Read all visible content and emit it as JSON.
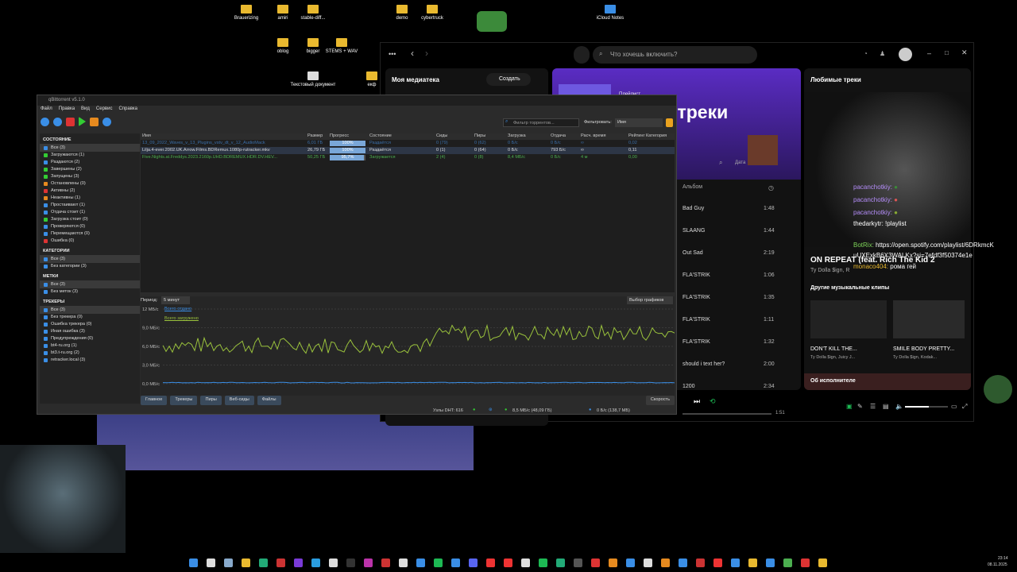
{
  "desktop": {
    "icons": [
      "Brauerizing",
      "amiri",
      "stable-diff...",
      "demo",
      "cybertruck",
      "iCloud Notes",
      "oblog",
      "bigger",
      "STEMS + WAV",
      "Текстовый документ",
      "екф"
    ]
  },
  "spotify": {
    "search_placeholder": "Что хочешь включить?",
    "library_title": "Моя медиатека",
    "create_label": "Создать",
    "playlist_title": "Любимые треки",
    "playlist_badge": "Плейлист",
    "hero_title": "ымые треки",
    "album_header": "Альбом",
    "tracks": [
      {
        "title": "Bad Guy",
        "duration": "1:48"
      },
      {
        "title": "SLAANG",
        "duration": "1:44"
      },
      {
        "title": "Out Sad",
        "duration": "2:19"
      },
      {
        "title": "FLA'STRIK",
        "duration": "1:06"
      },
      {
        "title": "FLA'STRIK",
        "duration": "1:35"
      },
      {
        "title": "FLA'STRIK",
        "duration": "1:11"
      },
      {
        "title": "FLA'STRIK",
        "duration": "1:32"
      },
      {
        "title": "should i text her?",
        "duration": "2:00"
      },
      {
        "title": "1200",
        "duration": "2:34"
      }
    ],
    "right_panel_title": "Любимые треки",
    "now_playing_title": "ON REPEAT (feat. Rich The Kid 2",
    "now_playing_artist": "Ty Dolla $ign, R",
    "other_clips": "Другие музыкальные клипы",
    "clips": [
      {
        "title": "DON'T KILL THE...",
        "artist": "Ty Dolla $ign, Juicy J..."
      },
      {
        "title": "SMILE BODY PRETTY...",
        "artist": "Ty Dolla $ign, Kodak..."
      }
    ],
    "about_artist": "Об исполнителе",
    "elapsed": "1:51",
    "date_label": "Дата"
  },
  "chat": [
    {
      "user": "pacanchotkiy:",
      "text": ""
    },
    {
      "user": "pacanchotkiy:",
      "text": ""
    },
    {
      "user": "pacanchotkiy:",
      "text": ""
    },
    {
      "user": "thedarkytr:",
      "text": "!playlist"
    },
    {
      "user": "BotRix:",
      "text": "https://open.spotify.com/playlist/6DRkmcK"
    },
    {
      "user": "",
      "text": "uUXExkB6X3WALKx?si=7efdf3f50374e1e"
    },
    {
      "user": "monaco404:",
      "text": "рома гей"
    }
  ],
  "qbt": {
    "title": "qBittorrent v5.1.0",
    "menu": [
      "Файл",
      "Правка",
      "Вид",
      "Сервис",
      "Справка"
    ],
    "filter_placeholder": "Фильтр торрентов...",
    "filter_label": "Фильтровать:",
    "filter_value": "Имя",
    "side": {
      "status_h": "СОСТОЯНИЕ",
      "status": [
        "Все (3)",
        "Загружаются (1)",
        "Раздаются (2)",
        "Завершены (2)",
        "Запущены (3)",
        "Остановлены (0)",
        "Активны (2)",
        "Неактивны (1)",
        "Простаивают (1)",
        "Отдача стоит (1)",
        "Загрузка стоит (0)",
        "Проверяются (0)",
        "Перемещаются (0)",
        "Ошибка (0)"
      ],
      "cat_h": "КАТЕГОРИИ",
      "cats": [
        "Все (3)",
        "Без категории (3)"
      ],
      "tags_h": "МЕТКИ",
      "tags": [
        "Все (3)",
        "Без меток (3)"
      ],
      "trackers_h": "ТРЕКЕРЫ",
      "trackers": [
        "Все (3)",
        "Без трекера (0)",
        "Ошибка трекера (0)",
        "Иная ошибка (3)",
        "Предупреждения (0)",
        "bt4-ru.org (1)",
        "bt3.t-ru.org (2)",
        "retracker.local (3)"
      ]
    },
    "columns": [
      "Имя",
      "Размер",
      "Прогресс",
      "Состояние",
      "Сиды",
      "Пиры",
      "Загрузка",
      "Отдача",
      "Расч. время",
      "Рейтинг",
      "Категория"
    ],
    "rows": [
      {
        "name": "13_09_2022_Waves_v_13_Plugins_vstv_dt_v_12_AudioMack",
        "size": "6,01 ГБ",
        "progress": 100,
        "progress_label": "100%",
        "state": "Раздаётся",
        "seeds": "0 (79)",
        "peers": "0 (62)",
        "down": "0 Б/с",
        "up": "0 Б/с",
        "eta": "∞",
        "ratio": "0,02"
      },
      {
        "name": "Lilja.4-ever.2002.UK.Arrow.Films.BDRemux.1080p-rutracker.mkv",
        "size": "26,79 ГБ",
        "progress": 100,
        "progress_label": "100%",
        "state": "Раздаётся",
        "seeds": "0 (1)",
        "peers": "0 (64)",
        "down": "0 Б/с",
        "up": "793 Б/с",
        "eta": "∞",
        "ratio": "0,11"
      },
      {
        "name": "Five.Nights.at.Freddys.2023.2160p.UHD.BDREMUX.HDR.DV.HEV...",
        "size": "50,25 ГБ",
        "progress": 95.7,
        "progress_label": "95,7%",
        "state": "Загружается",
        "seeds": "2 (4)",
        "peers": "0 (8)",
        "down": "8,4 МБ/с",
        "up": "0 Б/с",
        "eta": "4 м",
        "ratio": "0,00"
      }
    ],
    "period_label": "Период:",
    "period_value": "5 минут",
    "graph_select": "Выбор графиков",
    "y_ticks": [
      "12 МБ/с",
      "9,0 МБ/с",
      "6,0 МБ/с",
      "3,0 МБ/с",
      "0,0 МБ/с"
    ],
    "legend_up": "Всего отдано",
    "legend_down": "Всего загружено",
    "tabs": [
      "Главное",
      "Трекеры",
      "Пиры",
      "Веб-сиды",
      "Файлы"
    ],
    "speed_tab": "Скорость",
    "dht": "Узлы DHT: 616",
    "down_status": "8,5 МБ/с (48,09 ГБ)",
    "up_status": "0 Б/с (138,7 МБ)"
  },
  "clock": {
    "time": "23:14",
    "date": "08.11.2025"
  },
  "colors": {
    "spotify_green": "#1db954",
    "chat_purple": "#b38cf7",
    "qbt_accent": "#3a8ee6"
  }
}
